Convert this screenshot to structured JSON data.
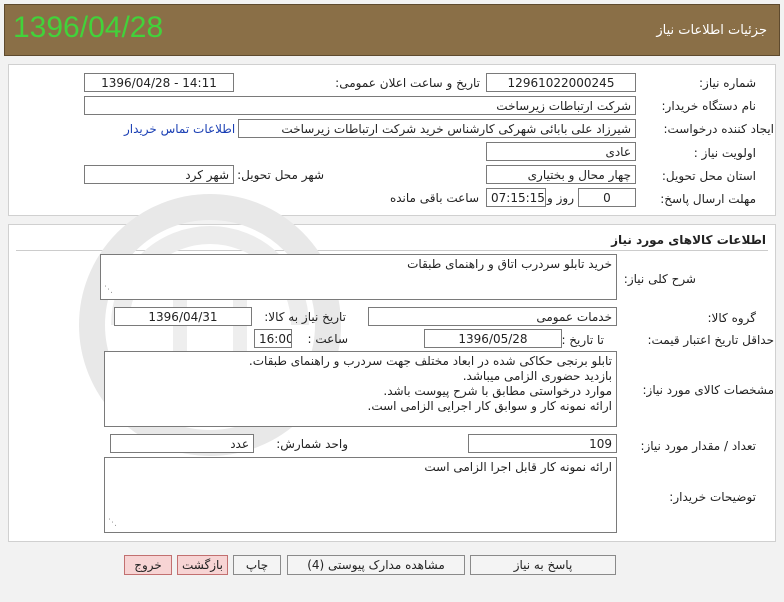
{
  "header": {
    "date": "1396/04/28",
    "title": "جزئیات اطلاعات نیاز"
  },
  "need_info": {
    "need_number_label": "شماره نیاز:",
    "need_number": "1296102200024‏5",
    "announce_label": "تاریخ و ساعت اعلان عمومی:",
    "announce_value": "1396/04/28 - 14:11",
    "buyer_label": "نام دستگاه خریدار:",
    "buyer_value": "شرکت ارتباطات زیرساخت",
    "creator_label": "ایجاد کننده درخواست:",
    "creator_value": "شیرزاد علی بابائی شهرکی کارشناس خرید شرکت ارتباطات زیرساخت",
    "contact_link": "اطلاعات تماس خریدار",
    "priority_label": "اولویت نیاز :",
    "priority_value": "عادی",
    "province_label": "استان محل تحویل:",
    "province_value": "چهار محال و بختیاری",
    "city_label": "شهر محل تحویل:",
    "city_value": "شهر کرد",
    "deadline_label": "مهلت ارسال پاسخ:",
    "days_value": "0",
    "days_label": "روز و",
    "time_value": "07:15:15",
    "remaining_label": "ساعت باقی مانده"
  },
  "goods": {
    "section_title": "اطلاعات کالاهای مورد نیاز",
    "summary_label": "شرح کلی نیاز:",
    "summary_value": "خرید تابلو سردرب اتاق و راهنمای طبقات",
    "group_label": "گروه کالا:",
    "group_value": "خدمات عمومی",
    "need_date_label": "تاریخ نیاز به کالا:",
    "need_date_value": "1396/04/31",
    "validity_label": "حداقل تاریخ اعتبار قیمت:",
    "until_date_label": "تا تاریخ :",
    "until_date_value": "1396/05/28",
    "hour_label": "ساعت :",
    "hour_value": "16:00",
    "spec_label": "مشخصات کالای مورد نیاز:",
    "spec_lines": [
      "تابلو برنجی حکاکی شده در ابعاد مختلف جهت سردرب و راهنمای طبقات.",
      "بازدید حضوری الزامی میباشد.",
      "موارد درخواستی مطابق با شرح پیوست باشد.",
      "ارائه نمونه کار و سوابق کار اجرایی الزامی است."
    ],
    "qty_label": "تعداد / مقدار مورد نیاز:",
    "qty_value": "109",
    "unit_label": "واحد شمارش:",
    "unit_value": "عدد",
    "buyer_notes_label": "توضیحات خریدار:",
    "buyer_notes_value": "ارائه نمونه کار قابل اجرا الزامی است"
  },
  "buttons": {
    "reply": "پاسخ به نیاز",
    "attachments": "مشاهده مدارک پیوستی (4)",
    "print": "چاپ",
    "back": "بازگشت",
    "exit": "خروج"
  },
  "colors": {
    "header_bg": "#8a6f47",
    "header_date": "#42d23a",
    "link": "#1a3fb4",
    "danger_btn": "#f7d4d4"
  }
}
